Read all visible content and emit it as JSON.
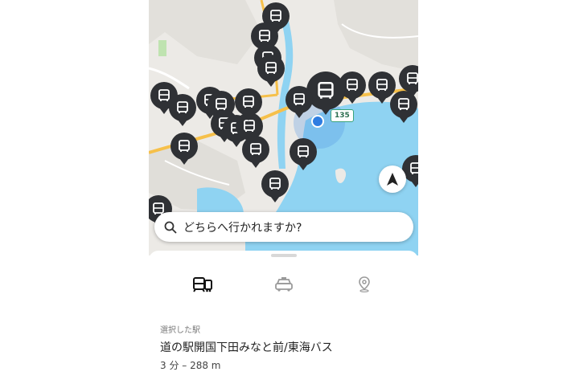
{
  "map": {
    "route_number": "135",
    "bus_stop_icon": "bus-icon",
    "current_location_icon": "location-dot-icon",
    "navigation_icon": "navigation-arrow-icon",
    "colors": {
      "water": "#8fd3f2",
      "land": "#eceae6",
      "road": "#f6c04a",
      "park": "#bfe3b0",
      "pin": "#2f3135"
    }
  },
  "search": {
    "icon": "search-icon",
    "placeholder": "どちらへ行かれますか?"
  },
  "tabs": [
    {
      "name": "train-bus",
      "icon": "train-bus-icon",
      "active": true
    },
    {
      "name": "taxi",
      "icon": "taxi-icon",
      "active": false
    },
    {
      "name": "place",
      "icon": "map-pin-icon",
      "active": false
    }
  ],
  "selected": {
    "label": "選択した駅",
    "station": "道の駅開国下田みなと前/東海バス",
    "distance": "3 分 – 288 m"
  }
}
